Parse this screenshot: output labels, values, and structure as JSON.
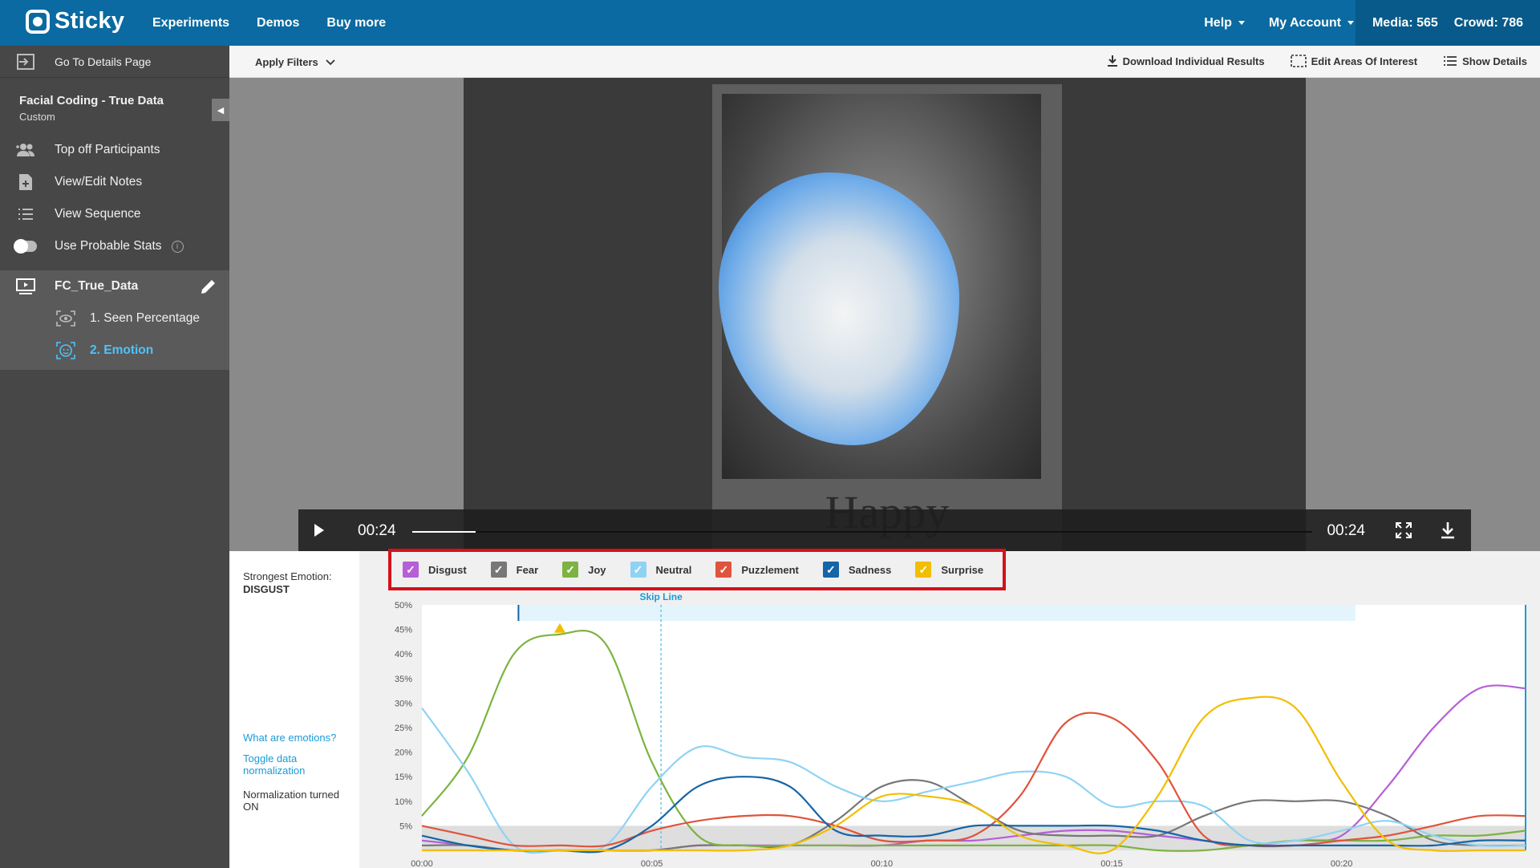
{
  "topbar": {
    "logo": "Sticky",
    "nav": [
      "Experiments",
      "Demos",
      "Buy more"
    ],
    "help": "Help",
    "account": "My Account",
    "media": "Media: 565",
    "crowd": "Crowd: 786"
  },
  "sidebar": {
    "go_details": "Go To Details Page",
    "experiment_title": "Facial Coding - True Data",
    "experiment_type": "Custom",
    "items": [
      "Top off Participants",
      "View/Edit Notes",
      "View Sequence",
      "Use Probable Stats"
    ],
    "media_name": "FC_True_Data",
    "sub_items": [
      "1. Seen Percentage",
      "2. Emotion"
    ]
  },
  "toolbar": {
    "apply_filters": "Apply Filters",
    "download": "Download Individual Results",
    "edit_aoi": "Edit Areas Of Interest",
    "show_details": "Show Details"
  },
  "video": {
    "caption": "Happy",
    "current_time": "00:24",
    "end_time": "00:24",
    "progress": 0.07
  },
  "panel": {
    "strongest_label": "Strongest Emotion:",
    "strongest_value": "DISGUST",
    "what_are": "What are emotions?",
    "toggle_norm": "Toggle data normalization",
    "norm_status": "Normalization turned ON",
    "skip_line": "Skip Line"
  },
  "colors": {
    "Disgust": "#b65fd6",
    "Fear": "#777777",
    "Joy": "#7cb342",
    "Neutral": "#8fd3f4",
    "Puzzlement": "#e0533c",
    "Sadness": "#1565a8",
    "Surprise": "#f2be00"
  },
  "chart_data": {
    "type": "line",
    "ylim": [
      0,
      50
    ],
    "y_ticks": [
      "50%",
      "45%",
      "40%",
      "35%",
      "30%",
      "25%",
      "20%",
      "15%",
      "10%",
      "5%"
    ],
    "x_ticks": [
      "00:00",
      "00:05",
      "00:10",
      "00:15",
      "00:20"
    ],
    "xlim": [
      0,
      24
    ],
    "skip_line_x": 5.2,
    "marker_x": 3.0,
    "x": [
      0,
      1,
      2,
      3,
      4,
      5,
      6,
      7,
      8,
      9,
      10,
      11,
      12,
      13,
      14,
      15,
      16,
      17,
      18,
      19,
      20,
      21,
      22,
      23,
      24
    ],
    "series": [
      {
        "name": "Disgust",
        "values": [
          2,
          1,
          0,
          0,
          0,
          0,
          1,
          1,
          1,
          1,
          1,
          2,
          2,
          3,
          4,
          4,
          3,
          2,
          1,
          2,
          3,
          13,
          25,
          33,
          33
        ]
      },
      {
        "name": "Fear",
        "values": [
          1,
          1,
          0,
          0,
          0,
          0,
          1,
          1,
          1,
          6,
          13,
          14,
          9,
          4,
          3,
          3,
          3,
          7,
          10,
          10,
          10,
          7,
          2,
          1,
          1
        ]
      },
      {
        "name": "Joy",
        "values": [
          7,
          19,
          40,
          44,
          42,
          18,
          3,
          1,
          1,
          1,
          1,
          1,
          1,
          1,
          1,
          1,
          0,
          0,
          1,
          2,
          2,
          2,
          3,
          3,
          4
        ]
      },
      {
        "name": "Neutral",
        "values": [
          29,
          16,
          1,
          0,
          1,
          13,
          21,
          19,
          18,
          13,
          10,
          12,
          14,
          16,
          15,
          9,
          10,
          9,
          2,
          2,
          4,
          6,
          3,
          1,
          1
        ]
      },
      {
        "name": "Puzzlement",
        "values": [
          5,
          3,
          1,
          1,
          1,
          4,
          6,
          7,
          7,
          5,
          2,
          2,
          3,
          11,
          26,
          27,
          18,
          3,
          1,
          1,
          2,
          3,
          5,
          7,
          7
        ]
      },
      {
        "name": "Sadness",
        "values": [
          3,
          1,
          0,
          0,
          0,
          5,
          13,
          15,
          13,
          4,
          3,
          3,
          5,
          5,
          5,
          5,
          4,
          2,
          1,
          1,
          1,
          1,
          1,
          2,
          2
        ]
      },
      {
        "name": "Surprise",
        "values": [
          0,
          0,
          0,
          0,
          0,
          0,
          0,
          0,
          1,
          5,
          11,
          11,
          9,
          3,
          1,
          0,
          11,
          27,
          31,
          29,
          14,
          2,
          0,
          0,
          0
        ]
      }
    ]
  }
}
